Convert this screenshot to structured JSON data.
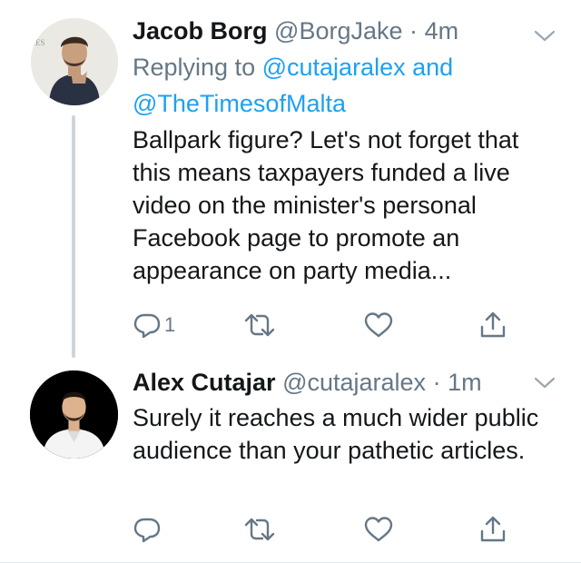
{
  "tweets": [
    {
      "display_name": "Jacob Borg",
      "handle": "@BorgJake",
      "separator": "·",
      "time": "4m",
      "replying_prefix": "Replying to",
      "replying_to_1": "@cutajaralex",
      "replying_and": "and",
      "replying_to_2": "@TheTimesofMalta",
      "text": "Ballpark figure? Let's not forget that this means taxpayers funded a live video on the minister's personal Facebook page to promote an appearance on party media...",
      "reply_count": "1",
      "avatar_icon": "user-avatar-photo"
    },
    {
      "display_name": "Alex Cutajar",
      "handle": "@cutajaralex",
      "separator": "·",
      "time": "1m",
      "text": "Surely it reaches a much wider public audience than your pathetic articles.",
      "reply_count": "",
      "avatar_icon": "user-avatar-photo"
    }
  ],
  "icons": {
    "reply": "reply-icon",
    "retweet": "retweet-icon",
    "like": "heart-icon",
    "share": "share-icon",
    "more": "chevron-down-icon"
  },
  "colors": {
    "text": "#14171a",
    "secondary": "#657786",
    "link": "#1da1f2",
    "thread_line": "#cdd5dc"
  }
}
